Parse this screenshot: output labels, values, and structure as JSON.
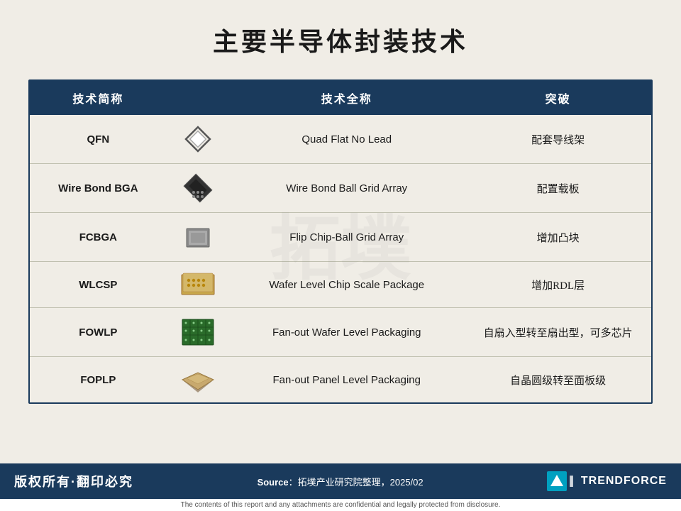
{
  "title": "主要半导体封装技术",
  "table": {
    "headers": {
      "abbr": "技术简称",
      "full": "技术全称",
      "breakthrough": "突破"
    },
    "rows": [
      {
        "abbr": "QFN",
        "icon": "qfn",
        "full": "Quad Flat No Lead",
        "breakthrough": "配套导线架"
      },
      {
        "abbr": "Wire Bond BGA",
        "icon": "wirebondbga",
        "full": "Wire Bond Ball Grid Array",
        "breakthrough": "配置载板"
      },
      {
        "abbr": "FCBGA",
        "icon": "fcbga",
        "full": "Flip Chip-Ball Grid Array",
        "breakthrough": "增加凸块"
      },
      {
        "abbr": "WLCSP",
        "icon": "wlcsp",
        "full": "Wafer Level Chip Scale Package",
        "breakthrough": "增加RDL层"
      },
      {
        "abbr": "FOWLP",
        "icon": "fowlp",
        "full": "Fan-out Wafer Level Packaging",
        "breakthrough": "自扇入型转至扇出型，可多芯片"
      },
      {
        "abbr": "FOPLP",
        "icon": "foplp",
        "full": "Fan-out Panel Level Packaging",
        "breakthrough": "自晶圆级转至面板级"
      }
    ]
  },
  "footer": {
    "copyright": "版权所有·翻印必究",
    "source_label": "Source",
    "source_text": "：拓墣产业研究院整理，2025/02",
    "logo_letter": "T",
    "logo_name": "TrendForce"
  },
  "disclaimer": "The contents of this report and any attachments are confidential and legally protected from disclosure."
}
